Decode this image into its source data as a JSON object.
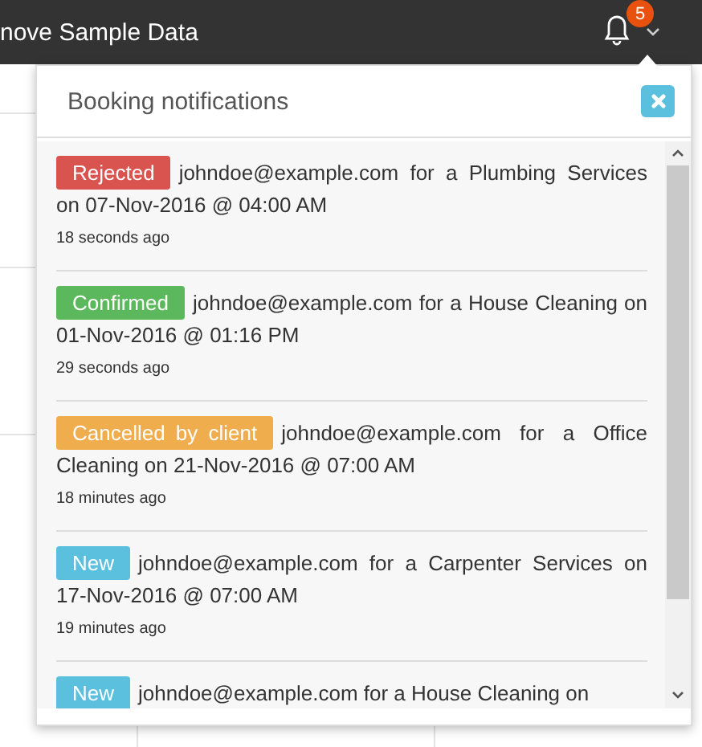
{
  "topbar": {
    "title": "nove Sample Data",
    "notification_count": "5"
  },
  "popup": {
    "title": "Booking notifications",
    "notifications": [
      {
        "kind": "rejected",
        "status": "Rejected",
        "text": "johndoe@example.com for a Plumbing Services on 07-Nov-2016 @ 04:00 AM",
        "time": "18 seconds ago"
      },
      {
        "kind": "confirmed",
        "status": "Confirmed",
        "text": "johndoe@example.com for a House Cleaning on 01-Nov-2016 @ 01:16 PM",
        "time": "29 seconds ago"
      },
      {
        "kind": "cancelled",
        "status": "Cancelled by client",
        "text": "johndoe@example.com for a Office Cleaning on 21-Nov-2016 @ 07:00 AM",
        "time": "18 minutes ago"
      },
      {
        "kind": "new",
        "status": "New",
        "text": "johndoe@example.com for a Carpenter Services on 17-Nov-2016 @ 07:00 AM",
        "time": "19 minutes ago"
      },
      {
        "kind": "new",
        "status": "New",
        "text": "johndoe@example.com for a House Cleaning on"
      }
    ]
  }
}
